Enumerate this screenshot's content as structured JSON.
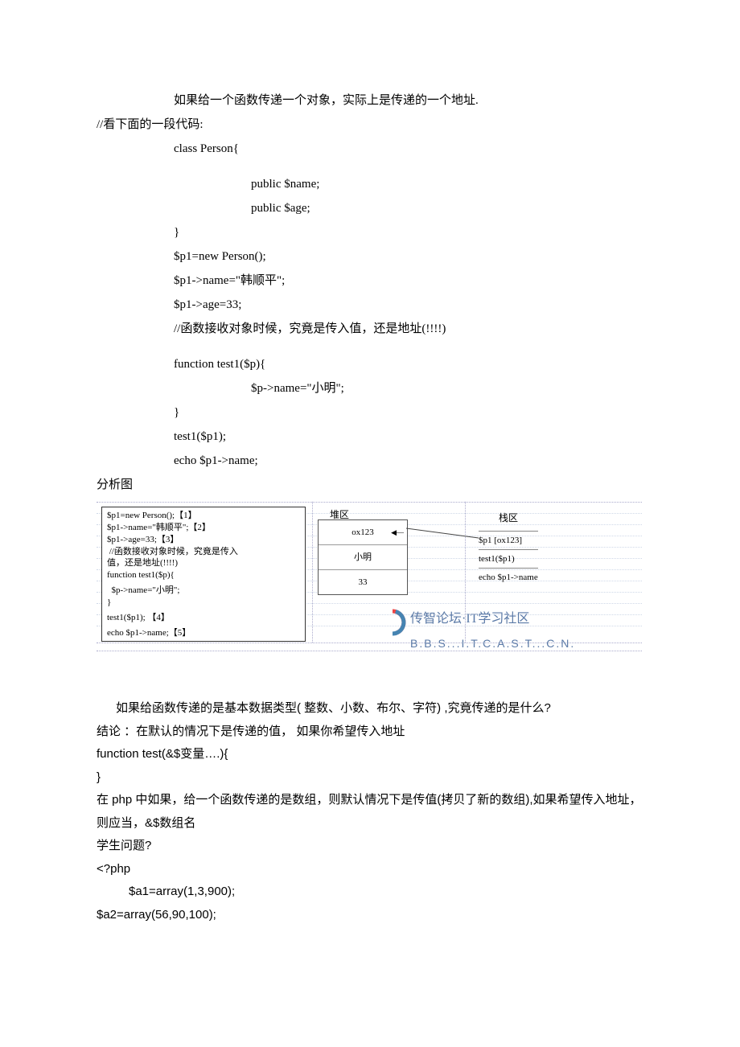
{
  "p1": "如果给一个函数传递一个对象，实际上是传递的一个地址.",
  "p2": "//看下面的一段代码:",
  "code": {
    "l1": "class Person{",
    "l2": "public $name;",
    "l3": "public $age;",
    "l4": "}",
    "l5": "$p1=new Person();",
    "l6": "$p1->name=\"韩顺平\";",
    "l7": "$p1->age=33;",
    "l8": "//函数接收对象时候，究竟是传入值，还是地址(!!!!)",
    "l9": "function test1($p){",
    "l10": "$p->name=\"小明\";",
    "l11": "}",
    "l12": "test1($p1);",
    "l13": "echo $p1->name;"
  },
  "diag_label": "分析图",
  "diagram": {
    "left": {
      "r1": "$p1=new Person();【1】",
      "r2": "$p1->name=\"韩顺平\";【2】",
      "r3": "$p1->age=33;【3】",
      "r4": " //函数接收对象时候，究竟是传入",
      "r5": "值，还是地址(!!!!)",
      "r6": "function test1($p){",
      "r7": "  $p->name=\"小明\";",
      "r8": "}",
      "r9": "test1($p1); 【4】",
      "r10": "echo $p1->name;【5】"
    },
    "heap_title": "堆区",
    "heap_addr": "ox123",
    "heap_v1": "小明",
    "heap_v2": "33",
    "stack_title": "栈区",
    "stack": {
      "s1": "$p1 [ox123]",
      "s2": "test1($p1)",
      "s3": "echo $p1->name"
    },
    "watermark_main": "传智论坛·IT学习社区",
    "watermark_sub": "B.B.S...I.T.C.A.S.T...C.N."
  },
  "post": {
    "q1": "如果给函数传递的是基本数据类型( 整数、小数、布尔、字符) ,究竟传递的是什么?",
    "a1": "结论 ：在默认的情况下是传递的值，  如果你希望传入地址",
    "fn": "function test(&$变量….){",
    "brace": "}",
    "arr": "在 php 中如果，给一个函数传递的是数组，则默认情况下是传值(拷贝了新的数组),如果希望传入地址，则应当，&$数组名",
    "sq": "学生问题?",
    "php_open": "<?php",
    "a1line": "$a1=array(1,3,900);",
    "a2line": "$a2=array(56,90,100);"
  }
}
